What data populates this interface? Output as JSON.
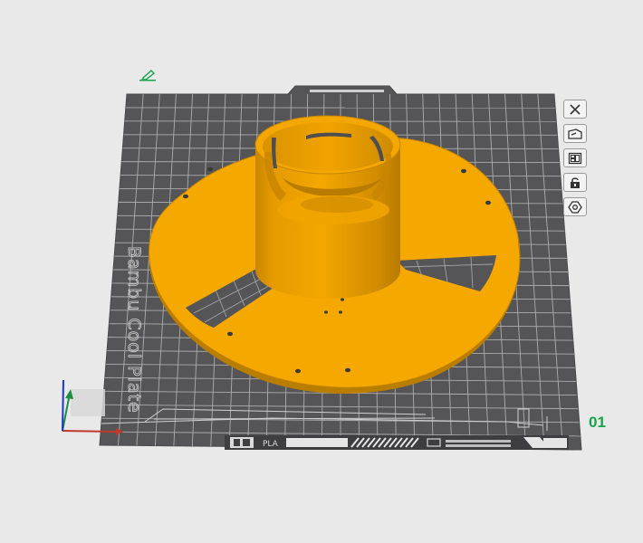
{
  "plate": {
    "brand_text": "Bambu Cool Plate",
    "material_label": "PLA",
    "plate_index": "01"
  },
  "colors": {
    "background": "#e9e9e9",
    "plate": "#555557",
    "grid": "#bdbdbd",
    "model": "#f5a800",
    "accent_green": "#16a34a"
  },
  "toolbar": {
    "buttons": [
      {
        "name": "close-plate-button",
        "icon": "close-icon"
      },
      {
        "name": "auto-orient-button",
        "icon": "orient-icon"
      },
      {
        "name": "arrange-button",
        "icon": "arrange-icon"
      },
      {
        "name": "lock-plate-button",
        "icon": "lock-icon"
      },
      {
        "name": "plate-settings-button",
        "icon": "gear-icon"
      }
    ]
  },
  "model": {
    "name": "spool-holder",
    "color": "#f5a800"
  }
}
